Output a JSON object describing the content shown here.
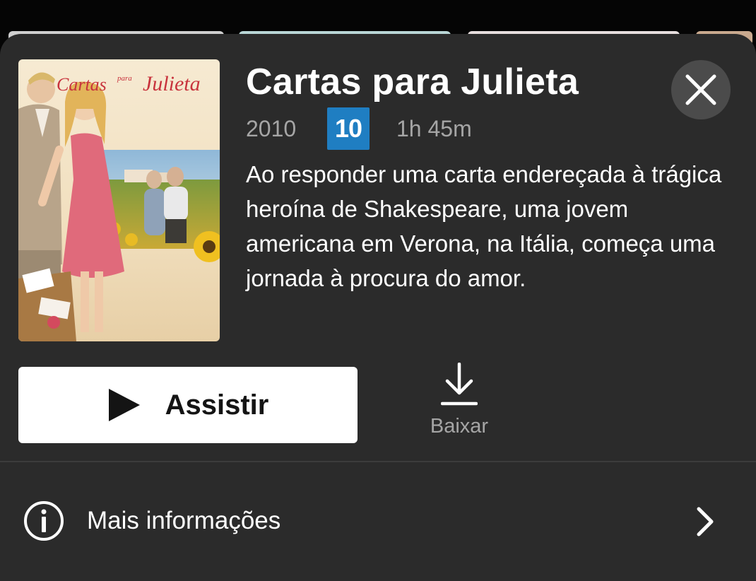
{
  "poster": {
    "title_text": "Cartas para Julieta"
  },
  "title": "Cartas para Julieta",
  "meta": {
    "year": "2010",
    "rating": "10",
    "rating_color": "#1f7ec2",
    "duration": "1h 45m"
  },
  "synopsis": "Ao responder uma carta endereçada à trágica heroína de Shakespeare, uma jovem americana em Verona, na Itália, começa uma jornada à procura do amor.",
  "actions": {
    "play_label": "Assistir",
    "play_icon": "play-icon",
    "download_label": "Baixar",
    "download_icon": "download-icon"
  },
  "more_info": {
    "label": "Mais informações",
    "icon": "info-icon",
    "chevron": "chevron-right-icon"
  },
  "close_icon": "close-icon",
  "colors": {
    "sheet_bg": "#2b2b2b",
    "text_primary": "#ffffff",
    "text_secondary": "#a5a5a5"
  }
}
